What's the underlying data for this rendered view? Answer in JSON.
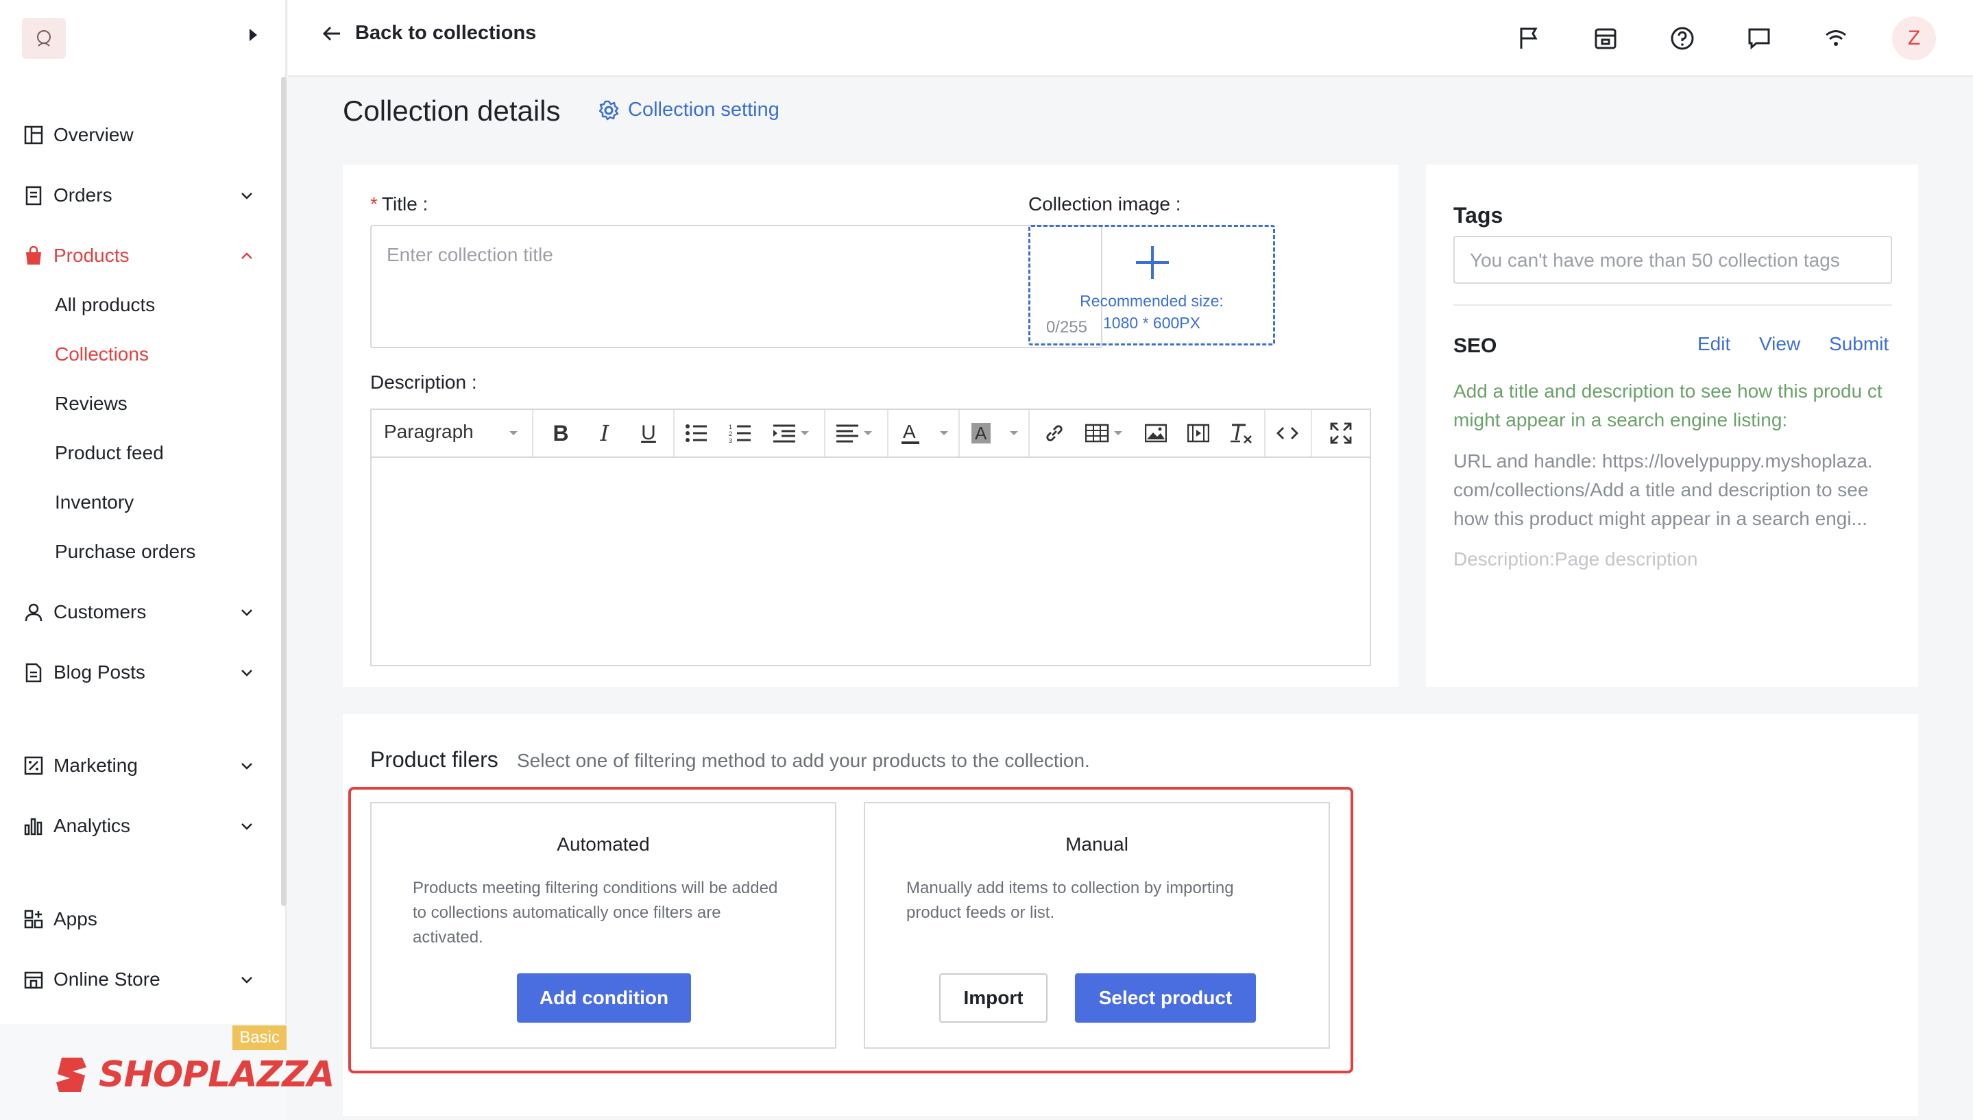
{
  "colors": {
    "accent": "#3b6fd4",
    "brand_red": "#e2413f",
    "primary_button": "#4a6ee0"
  },
  "sidebar": {
    "nav": [
      {
        "label": "Overview",
        "icon": "overview-icon"
      },
      {
        "label": "Orders",
        "icon": "orders-icon"
      },
      {
        "label": "Products",
        "icon": "products-icon",
        "active": true
      },
      {
        "label": "Customers",
        "icon": "customers-icon"
      },
      {
        "label": "Blog Posts",
        "icon": "blog-icon"
      },
      {
        "label": "Marketing",
        "icon": "marketing-icon"
      },
      {
        "label": "Analytics",
        "icon": "analytics-icon"
      },
      {
        "label": "Apps",
        "icon": "apps-icon"
      },
      {
        "label": "Online Store",
        "icon": "store-icon"
      }
    ],
    "products_sub": [
      "All products",
      "Collections",
      "Reviews",
      "Product feed",
      "Inventory",
      "Purchase orders"
    ],
    "active_sub": "Collections",
    "plan_badge": "Basic",
    "brand": "SHOPLAZZA"
  },
  "topbar": {
    "back_label": "Back to collections",
    "icons": [
      "flag-icon",
      "store-front-icon",
      "help-icon",
      "chat-icon",
      "wifi-icon"
    ],
    "avatar_initial": "Z"
  },
  "page": {
    "title": "Collection details",
    "setting_link": "Collection setting"
  },
  "form": {
    "title_label": "Title",
    "title_placeholder": "Enter collection title",
    "title_counter": "0/255",
    "image_label": "Collection image",
    "image_hint_line1": "Recommended size:",
    "image_hint_line2": "1080 * 600PX",
    "description_label": "Description",
    "paragraph_select": "Paragraph"
  },
  "tags": {
    "title": "Tags",
    "placeholder": "You can't have more than 50 collection tags"
  },
  "seo": {
    "title": "SEO",
    "edit": "Edit",
    "view": "View",
    "submit": "Submit",
    "hint": "Add a title and description to see how this produ ct might appear in a search engine listing:",
    "url_line": "URL and handle: https://lovelypuppy.myshoplaza. com/collections/Add a title and description to see how this product might appear in a search engi...",
    "description": "Description:Page description"
  },
  "filters": {
    "title": "Product filers",
    "subtitle": "Select one of filtering method to add your products to the collection.",
    "automated": {
      "heading": "Automated",
      "description": "Products meeting filtering conditions will be added to collections automatically once filters are activated.",
      "button": "Add condition"
    },
    "manual": {
      "heading": "Manual",
      "description": "Manually add items to collection by importing product feeds or list.",
      "import_button": "Import",
      "select_button": "Select product"
    }
  }
}
